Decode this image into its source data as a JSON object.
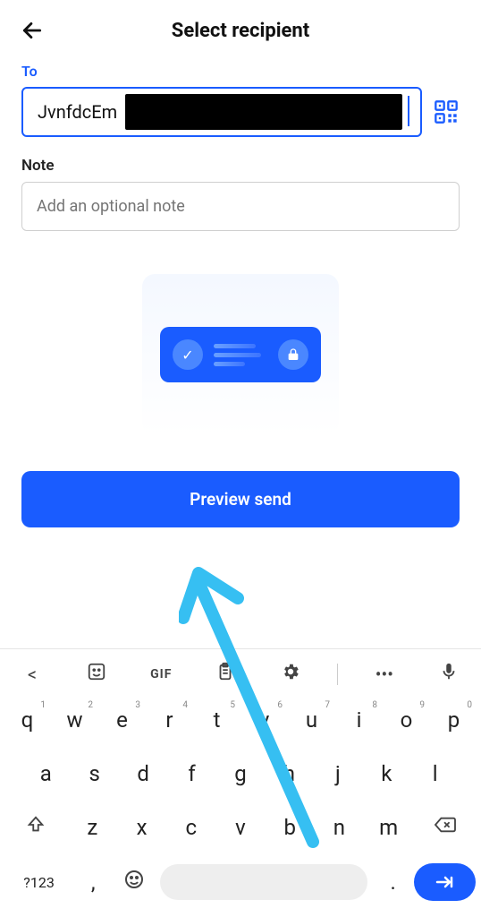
{
  "header": {
    "title": "Select recipient"
  },
  "form": {
    "to_label": "To",
    "to_value": "JvnfdcEm",
    "note_label": "Note",
    "note_placeholder": "Add an optional note"
  },
  "primary_button": {
    "label": "Preview send"
  },
  "keyboard": {
    "toolbar": {
      "chevron": "<",
      "gif": "GIF",
      "more": "•••"
    },
    "row1": [
      {
        "k": "q",
        "n": "1"
      },
      {
        "k": "w",
        "n": "2"
      },
      {
        "k": "e",
        "n": "3"
      },
      {
        "k": "r",
        "n": "4"
      },
      {
        "k": "t",
        "n": "5"
      },
      {
        "k": "y",
        "n": "6"
      },
      {
        "k": "u",
        "n": "7"
      },
      {
        "k": "i",
        "n": "8"
      },
      {
        "k": "o",
        "n": "9"
      },
      {
        "k": "p",
        "n": "0"
      }
    ],
    "row2": [
      "a",
      "s",
      "d",
      "f",
      "g",
      "h",
      "j",
      "k",
      "l"
    ],
    "row3": [
      "z",
      "x",
      "c",
      "v",
      "b",
      "n",
      "m"
    ],
    "row4": {
      "sym": "?123",
      "comma": ",",
      "dot": "."
    }
  },
  "colors": {
    "primary": "#1a5cff"
  }
}
